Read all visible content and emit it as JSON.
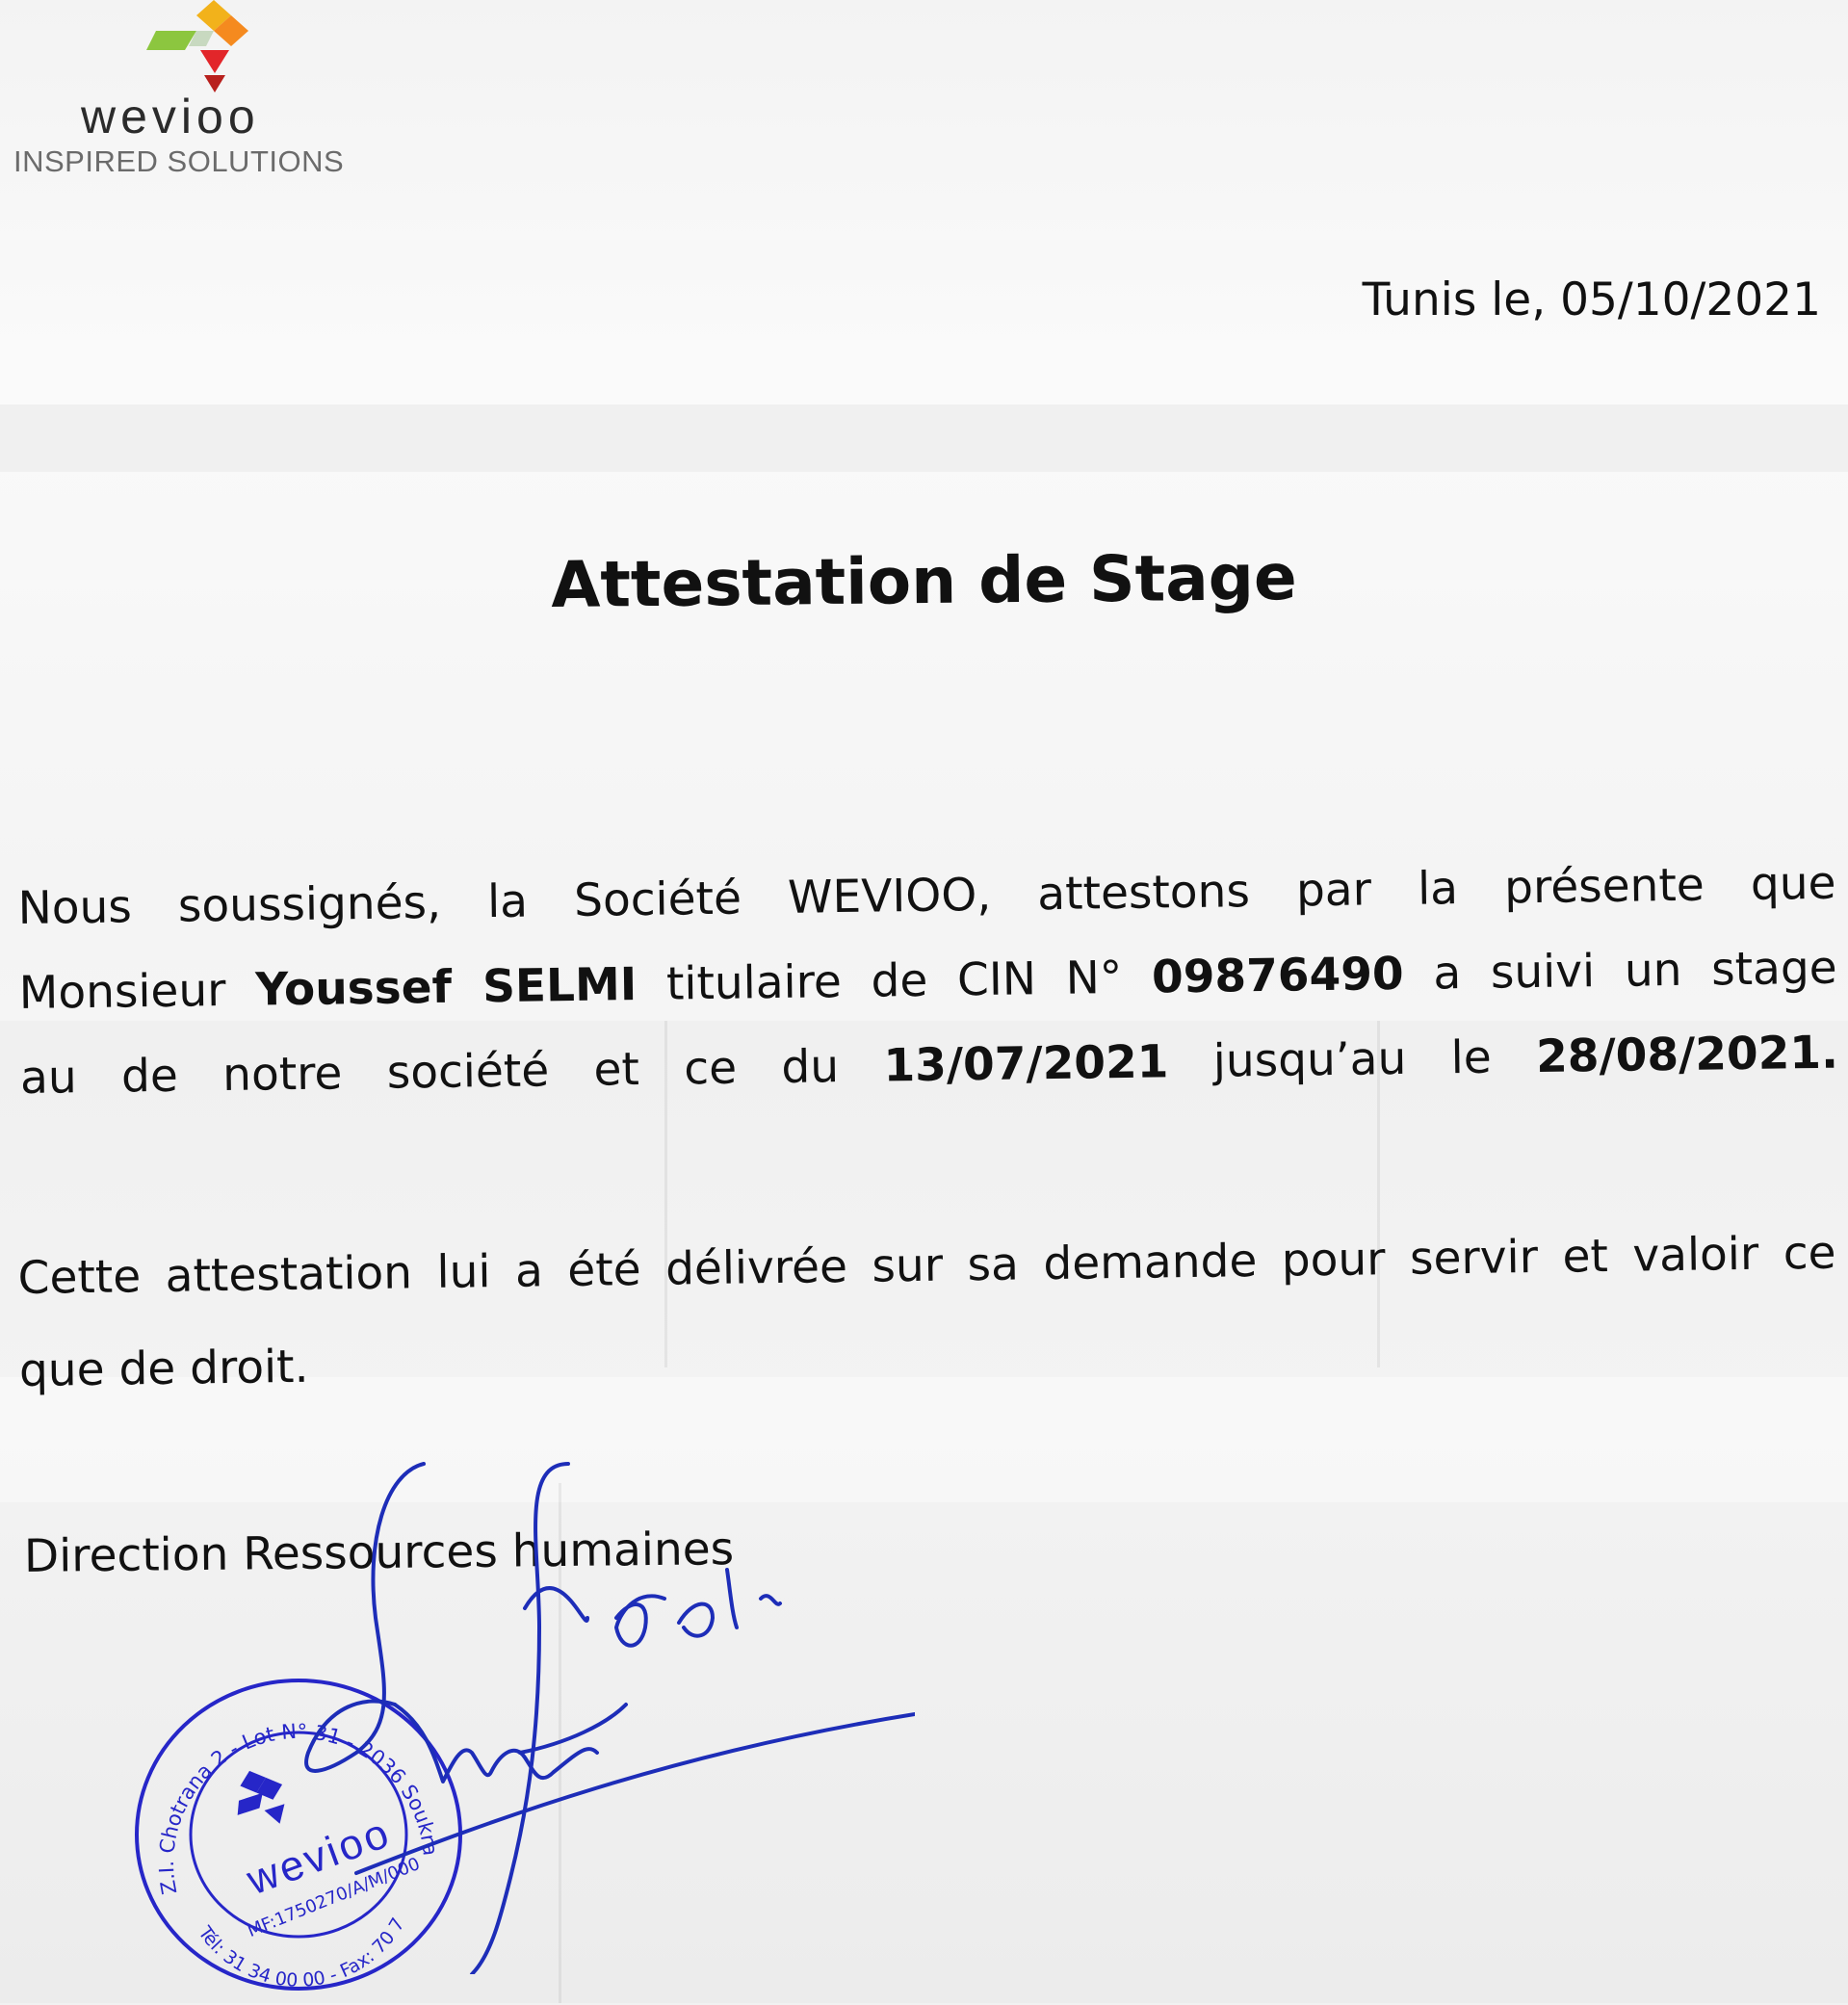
{
  "logo": {
    "word": "wevioo",
    "tagline": "INSPIRED SOLUTIONS",
    "colors": [
      "#f2b21b",
      "#e2262a",
      "#8cc63f",
      "#6b6b6b"
    ]
  },
  "header": {
    "date_line": "Tunis le, 05/10/2021"
  },
  "title": "Attestation de Stage",
  "paragraph1": {
    "line1": "Nous soussignés, la Société WEVIOO, attestons par la présente que",
    "line2_prefix": "Monsieur",
    "name": "Youssef SELMI",
    "line2_mid": "titulaire de CIN N°",
    "cin": "09876490",
    "line2_suffix": "a suivi un stage",
    "line3_prefix": "au de notre société et ce du",
    "date_start": "13/07/2021",
    "line3_mid": "jusqu’au le",
    "date_end": "28/08/2021."
  },
  "paragraph2": {
    "line1": "Cette attestation lui a été délivrée sur sa demande pour servir et valoir ce",
    "line2": "que de droit."
  },
  "signature_block": {
    "label": "Direction Ressources humaines"
  },
  "stamp": {
    "company": "wevioo",
    "address": "Z.I. Chotrana 2 - Lot N° 31 - 2036 Soukra",
    "mf": "MF:1750270/A/M/000",
    "tel": "Tél: 31 34 00 00 - Fax: 70 72 11 63",
    "color": "#2626c8"
  },
  "signature": {
    "color": "#1d2db8"
  }
}
